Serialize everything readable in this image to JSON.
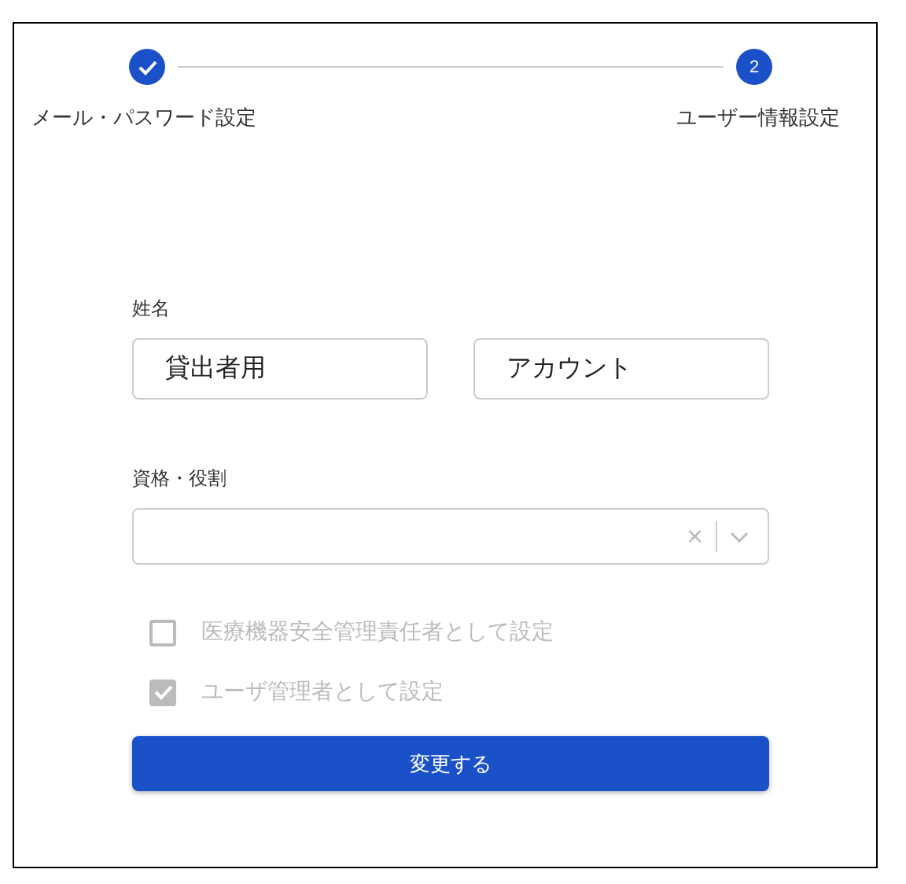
{
  "stepper": {
    "steps": [
      {
        "label": "メール・パスワード設定",
        "completed": true
      },
      {
        "label": "ユーザー情報設定",
        "number": "2",
        "completed": false
      }
    ]
  },
  "name_section": {
    "label": "姓名",
    "last_name": "貸出者用",
    "first_name": "アカウント"
  },
  "role_section": {
    "label": "資格・役割",
    "clear_icon": "×"
  },
  "options": [
    {
      "label": "医療機器安全管理責任者として設定",
      "checked": false,
      "disabled": true
    },
    {
      "label": "ユーザ管理者として設定",
      "checked": true,
      "disabled": true
    }
  ],
  "submit_button": "変更する"
}
